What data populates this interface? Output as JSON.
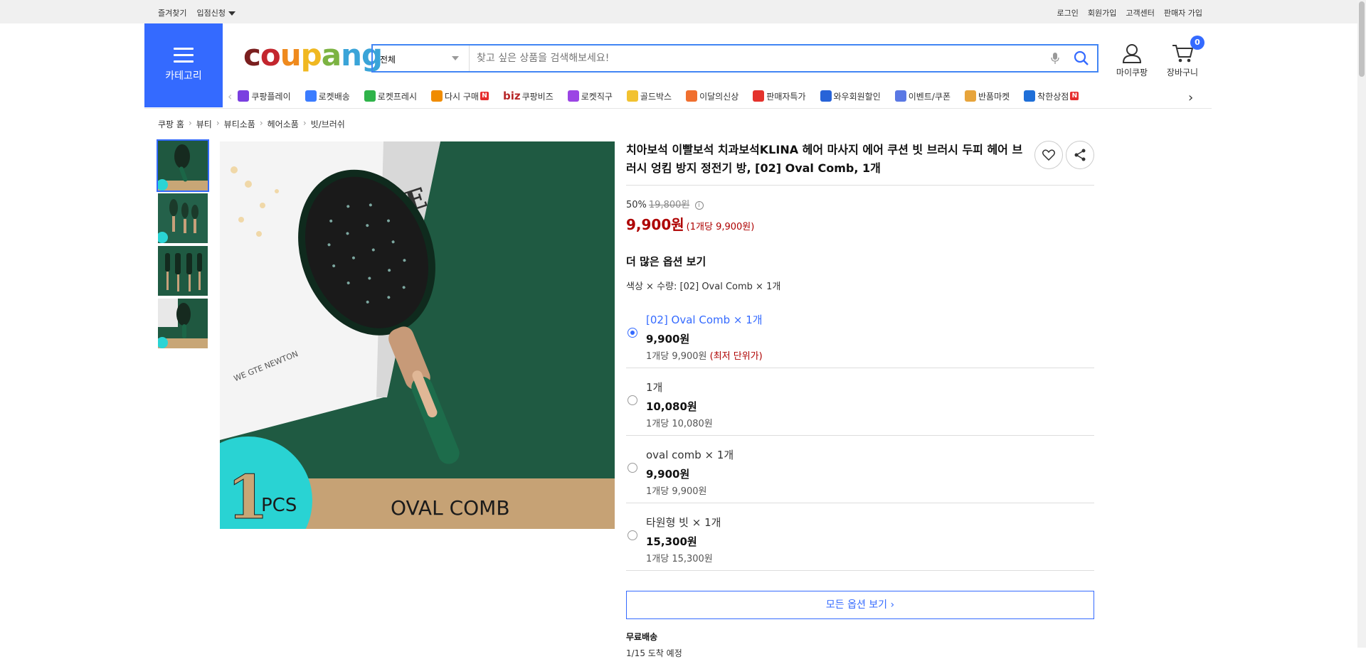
{
  "topbar": {
    "bookmark": "즐겨찾기",
    "join_store": "입점신청",
    "login": "로그인",
    "signup": "회원가입",
    "support": "고객센터",
    "seller_signup": "판매자 가입"
  },
  "header": {
    "category_label": "카테고리",
    "logo_text": [
      "c",
      "o",
      "u",
      "p",
      "a",
      "n",
      "g"
    ],
    "search_category": "전체",
    "search_placeholder": "찾고 싶은 상품을 검색해보세요!",
    "mypage_label": "마이쿠팡",
    "cart_label": "장바구니",
    "cart_count": "0"
  },
  "catnav": [
    {
      "label": "쿠팡플레이",
      "color": "#7a3fe0"
    },
    {
      "label": "로켓배송",
      "color": "#3b7cff"
    },
    {
      "label": "로켓프레시",
      "color": "#2fb34a"
    },
    {
      "label": "다시 구매",
      "color": "#f08c00",
      "badge": "N"
    },
    {
      "label": "쿠팡비즈",
      "prefix": "biz",
      "color": "#b8282a"
    },
    {
      "label": "로켓직구",
      "color": "#9b45e4"
    },
    {
      "label": "골드박스",
      "color": "#f2c230"
    },
    {
      "label": "이달의신상",
      "color": "#f06f2f"
    },
    {
      "label": "판매자특가",
      "color": "#e4322c"
    },
    {
      "label": "와우회원할인",
      "color": "#2763d8"
    },
    {
      "label": "이벤트/쿠폰",
      "color": "#5a78e4"
    },
    {
      "label": "반품마켓",
      "color": "#e7a43b"
    },
    {
      "label": "착한상점",
      "color": "#1f6fd8",
      "badge": "N"
    }
  ],
  "breadcrumb": [
    "쿠팡 홈",
    "뷰티",
    "뷰티소품",
    "헤어소품",
    "빗/브러쉬"
  ],
  "product": {
    "title": "치아보석 이빨보석 치과보석KLINA 헤어 마사지 에어 쿠션 빗 브러시 두피 헤어 브러시 엉킴 방지 정전기 방, [02] Oval Comb, 1개",
    "discount_rate": "50%",
    "original_price": "19,800원",
    "price": "9,900원",
    "unit_price": "(1개당 9,900원)",
    "more_options": "더 많은 옵션 보기",
    "selected_summary": "색상 × 수량: [02] Oval Comb × 1개",
    "image_text_1": "1",
    "image_text_pcs": "PCS",
    "image_text_name": "OVAL COMB",
    "image_text_box": "ORE",
    "image_text_box_small": "WE GTE NEWTON"
  },
  "options": [
    {
      "name": "[02] Oval Comb × 1개",
      "price": "9,900원",
      "unit": "1개당 9,900원",
      "note": "(최저 단위가)",
      "selected": true
    },
    {
      "name": "1개",
      "price": "10,080원",
      "unit": "1개당 10,080원",
      "note": "",
      "selected": false
    },
    {
      "name": "oval comb × 1개",
      "price": "9,900원",
      "unit": "1개당 9,900원",
      "note": "",
      "selected": false
    },
    {
      "name": "타원형 빗 × 1개",
      "price": "15,300원",
      "unit": "1개당 15,300원",
      "note": "",
      "selected": false
    }
  ],
  "all_options": "모든 옵션 보기 ›",
  "shipping": {
    "type": "무료배송",
    "eta": "1/15 도착 예정"
  },
  "colors": {
    "brand_blue": "#346aff",
    "price_red": "#ae0000"
  }
}
